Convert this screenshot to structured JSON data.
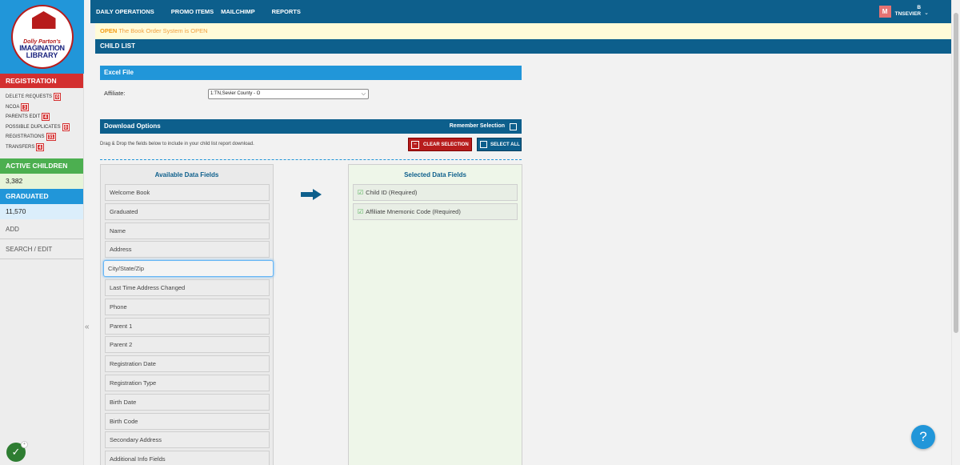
{
  "nav": {
    "items": [
      "DAILY OPERATIONS",
      "PROMO ITEMS",
      "MAILCHIMP",
      "REPORTS"
    ],
    "user_initial": "M",
    "user_top": "B",
    "user_name": "TNSEVIER"
  },
  "sidebar": {
    "logo": {
      "line1": "Dolly Parton's",
      "line2": "IMAGINATION",
      "line3": "LIBRARY"
    },
    "alerts_title": "REGISTRATION ALERTS",
    "alerts": [
      {
        "label": "DELETE REQUESTS",
        "count": "0"
      },
      {
        "label": "NCOA",
        "count": "3"
      },
      {
        "label": "PARENTS EDIT",
        "count": "4"
      },
      {
        "label": "POSSIBLE DUPLICATES",
        "count": "0"
      },
      {
        "label": "REGISTRATIONS",
        "count": "31"
      },
      {
        "label": "TRANSFERS",
        "count": "4"
      }
    ],
    "active_title": "ACTIVE CHILDREN",
    "active_count": "3,382",
    "graduated_title": "GRADUATED",
    "graduated_count": "11,570",
    "links": [
      "ADD",
      "SEARCH / EDIT"
    ]
  },
  "banner": {
    "status": "OPEN",
    "message": "The Book Order System is OPEN"
  },
  "page_title": "CHILD LIST",
  "excel": {
    "title": "Excel File",
    "affiliate_label": "Affiliate:",
    "affiliate_value": "1:TN,Sevier County - O"
  },
  "download": {
    "title": "Download Options",
    "remember_label": "Remember Selection",
    "help_text": "Drag & Drop the fields below to include in your child list report download.",
    "clear_label": "CLEAR SELECTION",
    "select_all_label": "SELECT ALL"
  },
  "available": {
    "title": "Available Data Fields",
    "fields": [
      "Welcome Book",
      "Graduated",
      "Name",
      "Address",
      "City/State/Zip",
      "Last Time Address Changed",
      "Phone",
      "Parent 1",
      "Parent 2",
      "Registration Date",
      "Registration Type",
      "Birth Date",
      "Birth Code",
      "Secondary Address",
      "Additional Info Fields"
    ]
  },
  "selected": {
    "title": "Selected Data Fields",
    "fields": [
      "Child ID (Required)",
      "Affiliate Mnemonic Code (Required)"
    ]
  },
  "help": "?"
}
